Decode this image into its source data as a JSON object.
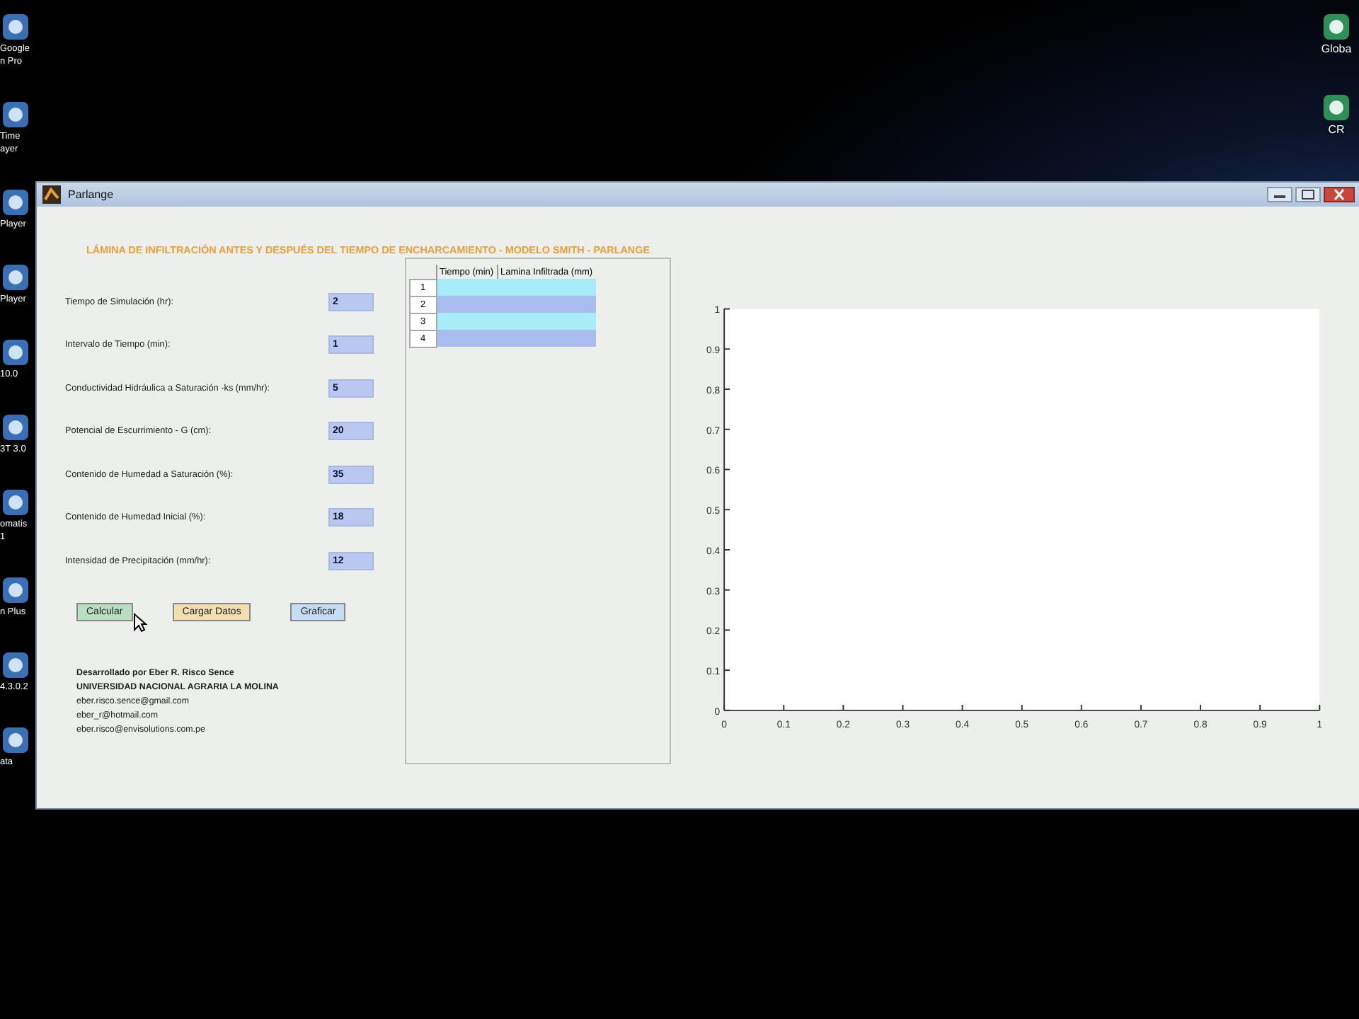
{
  "desktop_icons_left": [
    {
      "lines": [
        "Google",
        "n Pro"
      ]
    },
    {
      "lines": [
        "Time",
        "ayer"
      ]
    },
    {
      "lines": [
        "Player"
      ]
    },
    {
      "lines": [
        "Player"
      ]
    },
    {
      "lines": [
        "10.0"
      ]
    },
    {
      "lines": [
        "3T 3.0"
      ]
    },
    {
      "lines": [
        "omatis",
        "1"
      ]
    },
    {
      "lines": [
        "n Plus"
      ]
    },
    {
      "lines": [
        "4.3.0.2"
      ]
    },
    {
      "lines": [
        "ata"
      ]
    }
  ],
  "desktop_icons_right": [
    {
      "lines": [
        "Globa"
      ]
    },
    {
      "lines": [
        "CR"
      ]
    }
  ],
  "window": {
    "title": "Parlange",
    "heading": "LÁMINA DE INFILTRACIÓN ANTES Y DESPUÉS DEL TIEMPO DE ENCHARCAMIENTO - MODELO SMITH - PARLANGE",
    "fields": [
      {
        "label": "Tiempo de Simulación (hr):",
        "value": "2"
      },
      {
        "label": "Intervalo de Tiempo (min):",
        "value": "1"
      },
      {
        "label": "Conductividad Hidráulica a Saturación -ks (mm/hr):",
        "value": "5"
      },
      {
        "label": "Potencial de Escurrimiento - G (cm):",
        "value": "20"
      },
      {
        "label": "Contenido de Humedad a Saturación (%):",
        "value": "35"
      },
      {
        "label": "Contenido de Humedad Inicial (%):",
        "value": "18"
      },
      {
        "label": "Intensidad de Precipitación (mm/hr):",
        "value": "12"
      }
    ],
    "buttons": [
      {
        "label": "Calcular",
        "color": "#b8e0c0"
      },
      {
        "label": "Cargar Datos",
        "color": "#f3deb0"
      },
      {
        "label": "Graficar",
        "color": "#c4dcf4"
      }
    ],
    "credits": {
      "author": "Desarrollado por Eber R. Risco Sence",
      "university": "UNIVERSIDAD NACIONAL AGRARIA LA MOLINA",
      "emails": [
        "eber.risco.sence@gmail.com",
        "eber_r@hotmail.com",
        "eber.risco@envisolutions.com.pe"
      ]
    },
    "table": {
      "columns": [
        "Tiempo (min)",
        "Lamina Infiltrada (mm)"
      ],
      "rows": [
        "1",
        "2",
        "3",
        "4"
      ]
    },
    "chart": {
      "chart_data": {
        "type": "line",
        "xlim": [
          0,
          1
        ],
        "ylim": [
          0,
          1
        ],
        "xticks": [
          0,
          0.1,
          0.2,
          0.3,
          0.4,
          0.5,
          0.6,
          0.7,
          0.8,
          0.9,
          1
        ],
        "yticks": [
          0,
          0.1,
          0.2,
          0.3,
          0.4,
          0.5,
          0.6,
          0.7,
          0.8,
          0.9,
          1
        ]
      }
    }
  }
}
